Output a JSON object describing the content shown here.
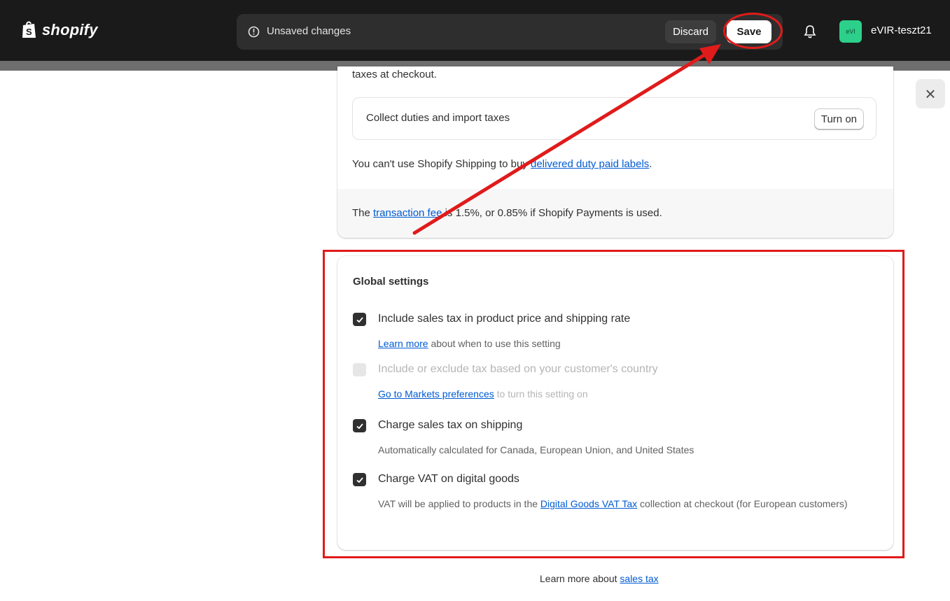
{
  "topbar": {
    "brand": "shopify",
    "unsaved_text": "Unsaved changes",
    "discard_label": "Discard",
    "save_label": "Save",
    "avatar_initials": "eVI",
    "store_name": "eVIR-teszt21"
  },
  "close_label": "×",
  "duties_card": {
    "lead_text": "taxes at checkout.",
    "duties_label": "Collect duties and import taxes",
    "turn_on_label": "Turn on",
    "shipping_note_before": "You can't use Shopify Shipping to buy ",
    "shipping_note_link": "delivered duty paid labels",
    "shipping_note_after": ".",
    "fee_before": "The ",
    "fee_link": "transaction fee",
    "fee_after": " is 1.5%, or 0.85% if Shopify Payments is used."
  },
  "global_settings": {
    "title": "Global settings",
    "options": [
      {
        "label": "Include sales tax in product price and shipping rate",
        "checked": true,
        "disabled": false,
        "help_link": "Learn more",
        "help_text": " about when to use this setting"
      },
      {
        "label": "Include or exclude tax based on your customer's country",
        "checked": false,
        "disabled": true,
        "help_link": "Go to Markets preferences",
        "help_text": " to turn this setting on"
      },
      {
        "label": "Charge sales tax on shipping",
        "checked": true,
        "disabled": false,
        "help_text": "Automatically calculated for Canada, European Union, and United States"
      },
      {
        "label": "Charge VAT on digital goods",
        "checked": true,
        "disabled": false,
        "help_before": "VAT will be applied to products in the ",
        "help_link": "Digital Goods VAT Tax",
        "help_after": " collection at checkout (for European customers)"
      }
    ]
  },
  "footer": {
    "learn_prefix": "Learn more about ",
    "learn_link": "sales tax"
  },
  "colors": {
    "topbar_bg": "#1a1a1a",
    "annotation_red": "#e01b1b",
    "link_blue": "#005bd3",
    "avatar_green": "#2cd08a"
  }
}
